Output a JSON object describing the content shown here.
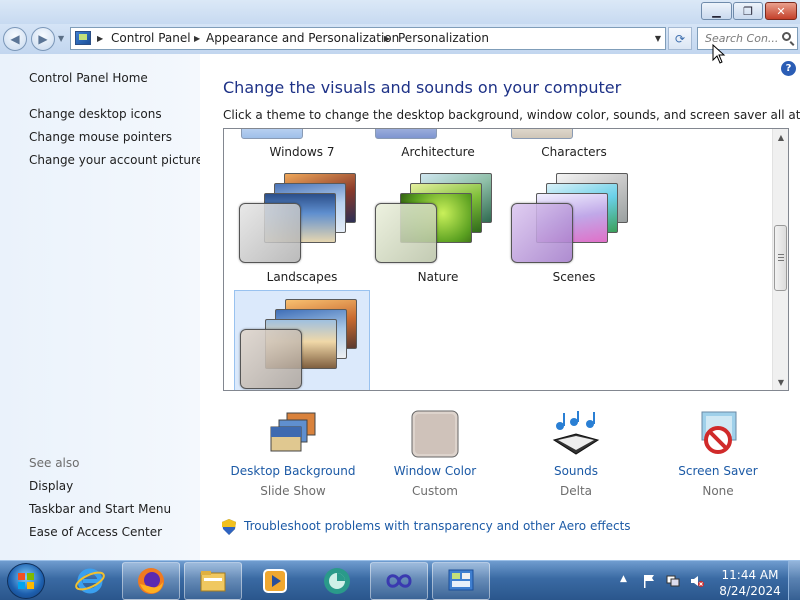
{
  "window": {
    "minimize_icon": "minimize-icon",
    "maximize_icon": "restore-icon",
    "close_icon": "close-icon",
    "min_glyph": "▁",
    "max_glyph": "❐",
    "close_glyph": "✕"
  },
  "nav": {
    "back_glyph": "◀",
    "forward_glyph": "▶",
    "dropdown_glyph": "▼",
    "breadcrumbs": [
      "Control Panel",
      "Appearance and Personalization",
      "Personalization"
    ],
    "separator": "▶",
    "address_dropdown_glyph": "▼",
    "refresh_glyph": "⟳",
    "search_placeholder": "Search Con..."
  },
  "sidebar": {
    "home": "Control Panel Home",
    "links": [
      "Change desktop icons",
      "Change mouse pointers",
      "Change your account picture"
    ],
    "see_also_label": "See also",
    "see_also": [
      "Display",
      "Taskbar and Start Menu",
      "Ease of Access Center"
    ]
  },
  "main": {
    "help_glyph": "?",
    "title": "Change the visuals and sounds on your computer",
    "subtitle": "Click a theme to change the desktop background, window color, sounds, and screen saver all at once.",
    "themes_row1": [
      "Windows 7",
      "Architecture",
      "Characters"
    ],
    "themes_row2": [
      "Landscapes",
      "Nature",
      "Scenes"
    ],
    "selected_theme_index": 6,
    "scroll_up": "▲",
    "scroll_down": "▼",
    "settings": [
      {
        "name": "Desktop Background",
        "value": "Slide Show",
        "icon": "desktop-background-icon"
      },
      {
        "name": "Window Color",
        "value": "Custom",
        "icon": "window-color-icon"
      },
      {
        "name": "Sounds",
        "value": "Delta",
        "icon": "sounds-icon"
      },
      {
        "name": "Screen Saver",
        "value": "None",
        "icon": "screen-saver-icon"
      }
    ],
    "troubleshoot": "Troubleshoot problems with transparency and other Aero effects"
  },
  "taskbar": {
    "time": "11:44 AM",
    "date": "8/24/2024"
  }
}
